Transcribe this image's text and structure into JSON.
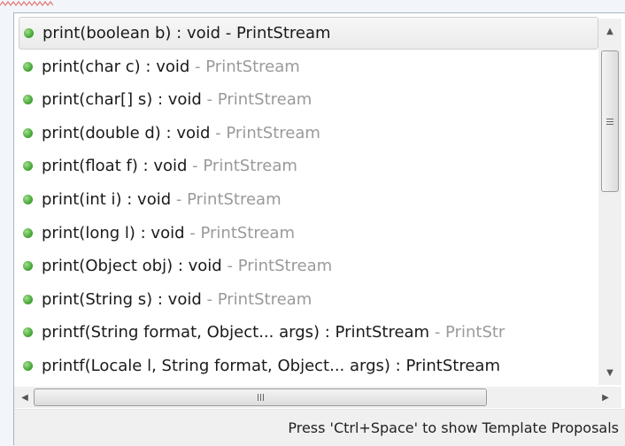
{
  "proposals": {
    "items": [
      {
        "signature": "print(boolean b) : void",
        "separator": " - ",
        "owner": "PrintStream",
        "icon": "public-method-icon",
        "selected": true
      },
      {
        "signature": "print(char c) : void",
        "separator": " - ",
        "owner": "PrintStream",
        "icon": "public-method-icon"
      },
      {
        "signature": "print(char[] s) : void",
        "separator": " - ",
        "owner": "PrintStream",
        "icon": "public-method-icon"
      },
      {
        "signature": "print(double d) : void",
        "separator": " - ",
        "owner": "PrintStream",
        "icon": "public-method-icon"
      },
      {
        "signature": "print(float f) : void",
        "separator": " - ",
        "owner": "PrintStream",
        "icon": "public-method-icon"
      },
      {
        "signature": "print(int i) : void",
        "separator": " - ",
        "owner": "PrintStream",
        "icon": "public-method-icon"
      },
      {
        "signature": "print(long l) : void",
        "separator": " - ",
        "owner": "PrintStream",
        "icon": "public-method-icon"
      },
      {
        "signature": "print(Object obj) : void",
        "separator": " - ",
        "owner": "PrintStream",
        "icon": "public-method-icon"
      },
      {
        "signature": "print(String s) : void",
        "separator": " - ",
        "owner": "PrintStream",
        "icon": "public-method-icon"
      },
      {
        "signature": "printf(String format, Object... args) : PrintStream",
        "separator": " - ",
        "owner": "PrintStr",
        "icon": "public-method-icon"
      },
      {
        "signature": "printf(Locale l, String format, Object... args) : PrintStream",
        "separator": "",
        "owner": "",
        "icon": "public-method-icon"
      }
    ]
  },
  "scrollbars": {
    "up_arrow": "▲",
    "down_arrow": "▼",
    "left_arrow": "◀",
    "right_arrow": "▶"
  },
  "status": {
    "text": "Press 'Ctrl+Space' to show Template Proposals"
  },
  "colors": {
    "method_icon": "#4caf3a",
    "owner_text": "#9a9a9a",
    "squiggle": "#d9534f"
  }
}
